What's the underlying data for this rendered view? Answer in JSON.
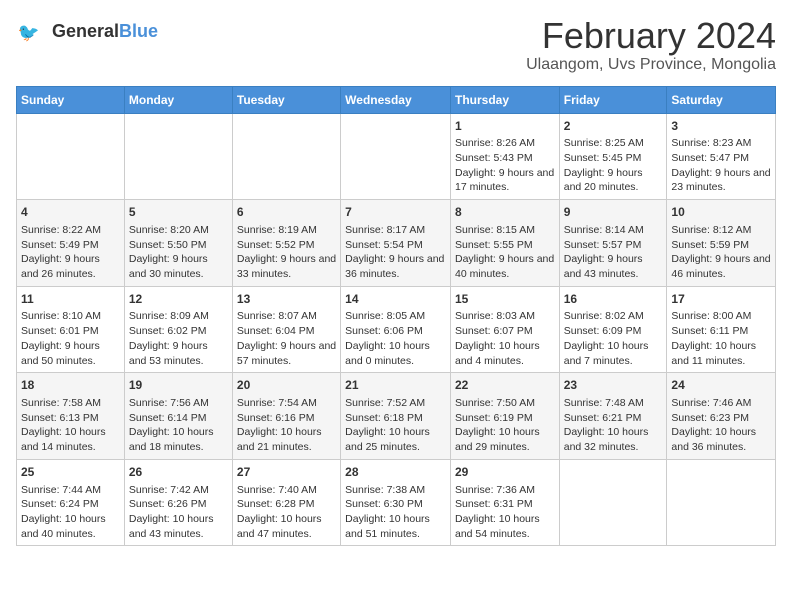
{
  "header": {
    "logo_line1": "General",
    "logo_line2": "Blue",
    "title": "February 2024",
    "subtitle": "Ulaangom, Uvs Province, Mongolia"
  },
  "days_of_week": [
    "Sunday",
    "Monday",
    "Tuesday",
    "Wednesday",
    "Thursday",
    "Friday",
    "Saturday"
  ],
  "weeks": [
    [
      {
        "day": "",
        "content": ""
      },
      {
        "day": "",
        "content": ""
      },
      {
        "day": "",
        "content": ""
      },
      {
        "day": "",
        "content": ""
      },
      {
        "day": "1",
        "content": "Sunrise: 8:26 AM\nSunset: 5:43 PM\nDaylight: 9 hours and 17 minutes."
      },
      {
        "day": "2",
        "content": "Sunrise: 8:25 AM\nSunset: 5:45 PM\nDaylight: 9 hours and 20 minutes."
      },
      {
        "day": "3",
        "content": "Sunrise: 8:23 AM\nSunset: 5:47 PM\nDaylight: 9 hours and 23 minutes."
      }
    ],
    [
      {
        "day": "4",
        "content": "Sunrise: 8:22 AM\nSunset: 5:49 PM\nDaylight: 9 hours and 26 minutes."
      },
      {
        "day": "5",
        "content": "Sunrise: 8:20 AM\nSunset: 5:50 PM\nDaylight: 9 hours and 30 minutes."
      },
      {
        "day": "6",
        "content": "Sunrise: 8:19 AM\nSunset: 5:52 PM\nDaylight: 9 hours and 33 minutes."
      },
      {
        "day": "7",
        "content": "Sunrise: 8:17 AM\nSunset: 5:54 PM\nDaylight: 9 hours and 36 minutes."
      },
      {
        "day": "8",
        "content": "Sunrise: 8:15 AM\nSunset: 5:55 PM\nDaylight: 9 hours and 40 minutes."
      },
      {
        "day": "9",
        "content": "Sunrise: 8:14 AM\nSunset: 5:57 PM\nDaylight: 9 hours and 43 minutes."
      },
      {
        "day": "10",
        "content": "Sunrise: 8:12 AM\nSunset: 5:59 PM\nDaylight: 9 hours and 46 minutes."
      }
    ],
    [
      {
        "day": "11",
        "content": "Sunrise: 8:10 AM\nSunset: 6:01 PM\nDaylight: 9 hours and 50 minutes."
      },
      {
        "day": "12",
        "content": "Sunrise: 8:09 AM\nSunset: 6:02 PM\nDaylight: 9 hours and 53 minutes."
      },
      {
        "day": "13",
        "content": "Sunrise: 8:07 AM\nSunset: 6:04 PM\nDaylight: 9 hours and 57 minutes."
      },
      {
        "day": "14",
        "content": "Sunrise: 8:05 AM\nSunset: 6:06 PM\nDaylight: 10 hours and 0 minutes."
      },
      {
        "day": "15",
        "content": "Sunrise: 8:03 AM\nSunset: 6:07 PM\nDaylight: 10 hours and 4 minutes."
      },
      {
        "day": "16",
        "content": "Sunrise: 8:02 AM\nSunset: 6:09 PM\nDaylight: 10 hours and 7 minutes."
      },
      {
        "day": "17",
        "content": "Sunrise: 8:00 AM\nSunset: 6:11 PM\nDaylight: 10 hours and 11 minutes."
      }
    ],
    [
      {
        "day": "18",
        "content": "Sunrise: 7:58 AM\nSunset: 6:13 PM\nDaylight: 10 hours and 14 minutes."
      },
      {
        "day": "19",
        "content": "Sunrise: 7:56 AM\nSunset: 6:14 PM\nDaylight: 10 hours and 18 minutes."
      },
      {
        "day": "20",
        "content": "Sunrise: 7:54 AM\nSunset: 6:16 PM\nDaylight: 10 hours and 21 minutes."
      },
      {
        "day": "21",
        "content": "Sunrise: 7:52 AM\nSunset: 6:18 PM\nDaylight: 10 hours and 25 minutes."
      },
      {
        "day": "22",
        "content": "Sunrise: 7:50 AM\nSunset: 6:19 PM\nDaylight: 10 hours and 29 minutes."
      },
      {
        "day": "23",
        "content": "Sunrise: 7:48 AM\nSunset: 6:21 PM\nDaylight: 10 hours and 32 minutes."
      },
      {
        "day": "24",
        "content": "Sunrise: 7:46 AM\nSunset: 6:23 PM\nDaylight: 10 hours and 36 minutes."
      }
    ],
    [
      {
        "day": "25",
        "content": "Sunrise: 7:44 AM\nSunset: 6:24 PM\nDaylight: 10 hours and 40 minutes."
      },
      {
        "day": "26",
        "content": "Sunrise: 7:42 AM\nSunset: 6:26 PM\nDaylight: 10 hours and 43 minutes."
      },
      {
        "day": "27",
        "content": "Sunrise: 7:40 AM\nSunset: 6:28 PM\nDaylight: 10 hours and 47 minutes."
      },
      {
        "day": "28",
        "content": "Sunrise: 7:38 AM\nSunset: 6:30 PM\nDaylight: 10 hours and 51 minutes."
      },
      {
        "day": "29",
        "content": "Sunrise: 7:36 AM\nSunset: 6:31 PM\nDaylight: 10 hours and 54 minutes."
      },
      {
        "day": "",
        "content": ""
      },
      {
        "day": "",
        "content": ""
      }
    ]
  ]
}
